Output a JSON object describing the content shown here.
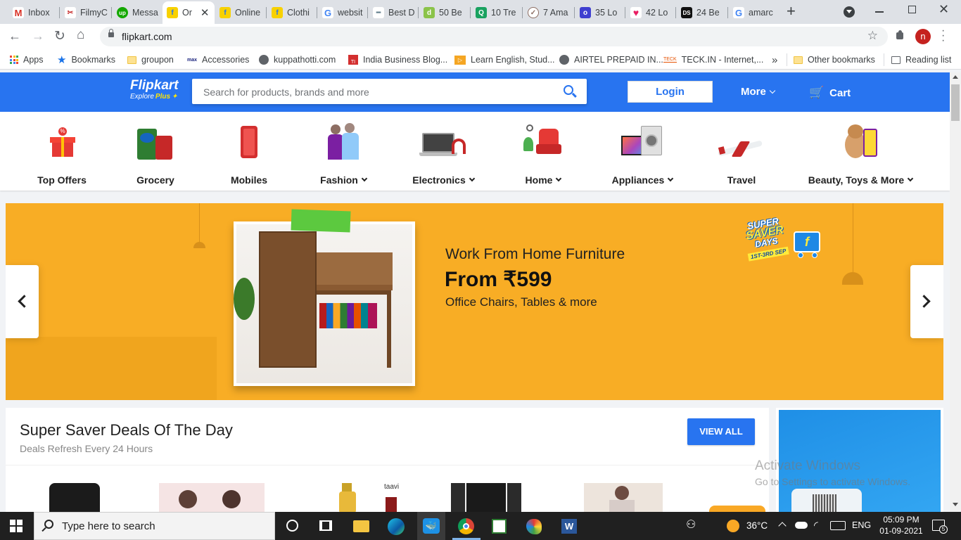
{
  "browser": {
    "tabs": [
      {
        "label": "Inbox",
        "icon": "gmail-icon"
      },
      {
        "label": "FilmyC",
        "icon": "filmy-icon"
      },
      {
        "label": "Messa",
        "icon": "upwork-icon"
      },
      {
        "label": "Or",
        "icon": "flipkart-icon",
        "active": true
      },
      {
        "label": "Online",
        "icon": "flipkart-icon"
      },
      {
        "label": "Clothi",
        "icon": "flipkart-icon"
      },
      {
        "label": "websit",
        "icon": "google-icon"
      },
      {
        "label": "Best D",
        "icon": "bestd-icon"
      },
      {
        "label": "50 Be",
        "icon": "d-icon"
      },
      {
        "label": "10 Tre",
        "icon": "quora-icon"
      },
      {
        "label": "7 Ama",
        "icon": "amara-icon"
      },
      {
        "label": "35 Lo",
        "icon": "looka-icon"
      },
      {
        "label": "42 Lo",
        "icon": "heart-icon"
      },
      {
        "label": "24 Be",
        "icon": "ds-icon"
      },
      {
        "label": "amarc",
        "icon": "google-icon"
      }
    ],
    "url": "flipkart.com",
    "profile_initial": "n",
    "bookmarks": [
      {
        "label": "Apps",
        "icon": "apps-grid-icon"
      },
      {
        "label": "Bookmarks",
        "icon": "star-icon"
      },
      {
        "label": "groupon",
        "icon": "folder-icon"
      },
      {
        "label": "Accessories",
        "icon": "max-icon"
      },
      {
        "label": "kuppathotti.com",
        "icon": "globe-icon"
      },
      {
        "label": "India Business Blog...",
        "icon": "tiny-icon"
      },
      {
        "label": "Learn English, Stud...",
        "icon": "play-icon"
      },
      {
        "label": "AIRTEL PREPAID IN...",
        "icon": "globe-icon"
      },
      {
        "label": "TECK.IN - Internet,...",
        "icon": "teck-icon"
      }
    ],
    "more_bookmarks": "»",
    "other_bookmarks": "Other bookmarks",
    "reading_list": "Reading list"
  },
  "header": {
    "logo": "Flipkart",
    "logo_sub": "Explore",
    "logo_plus": "Plus",
    "search_placeholder": "Search for products, brands and more",
    "login": "Login",
    "more": "More",
    "cart": "Cart"
  },
  "categories": [
    {
      "label": "Top Offers",
      "chevron": false
    },
    {
      "label": "Grocery",
      "chevron": false
    },
    {
      "label": "Mobiles",
      "chevron": false
    },
    {
      "label": "Fashion",
      "chevron": true
    },
    {
      "label": "Electronics",
      "chevron": true
    },
    {
      "label": "Home",
      "chevron": true
    },
    {
      "label": "Appliances",
      "chevron": true
    },
    {
      "label": "Travel",
      "chevron": false
    },
    {
      "label": "Beauty, Toys & More",
      "chevron": true
    }
  ],
  "banner": {
    "title": "Work From Home Furniture",
    "price": "From ₹599",
    "subtitle": "Office Chairs, Tables & more",
    "badge_line1": "SUPER",
    "badge_line2": "SAVER",
    "badge_line3": "DAYS",
    "badge_dates": "1ST-3RD SEP",
    "colors": {
      "background": "#f8ad25",
      "badge": "#1e88e5"
    }
  },
  "deals": {
    "title": "Super Saver Deals Of The Day",
    "subtitle": "Deals Refresh Every 24 Hours",
    "view_all": "VIEW ALL",
    "product_brand": "taavi"
  },
  "watermark": {
    "line1": "Activate Windows",
    "line2": "Go to Settings to activate Windows."
  },
  "taskbar": {
    "search_placeholder": "Type here to search",
    "weather": "36°C",
    "language": "ENG",
    "time": "05:09 PM",
    "date": "01-09-2021",
    "notifications": "5"
  }
}
